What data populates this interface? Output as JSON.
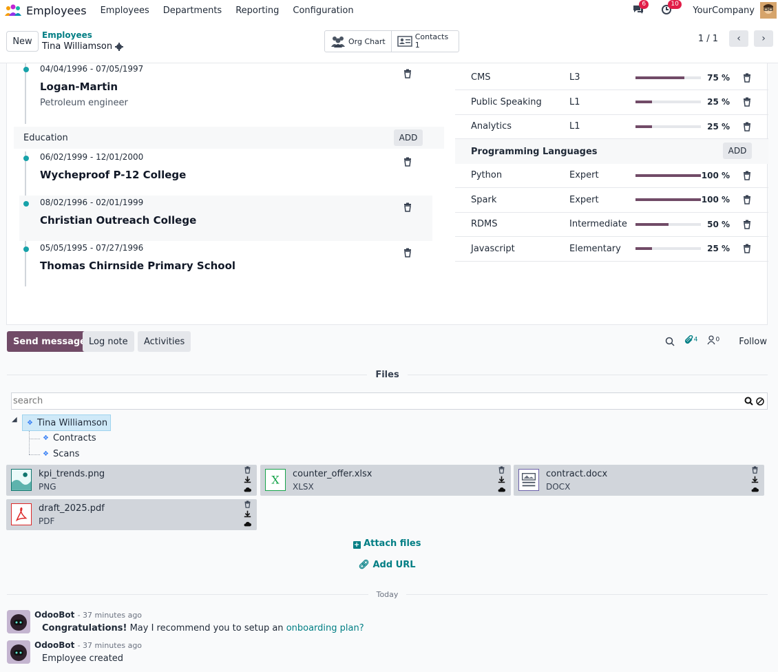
{
  "navbar": {
    "app_title": "Employees",
    "menu": [
      "Employees",
      "Departments",
      "Reporting",
      "Configuration"
    ],
    "messages_count": "6",
    "activities_count": "10",
    "company": "YourCompany"
  },
  "control_panel": {
    "new_label": "New",
    "breadcrumb_parent": "Employees",
    "breadcrumb_current": "Tina Williamson",
    "org_chart_label": "Org Chart",
    "contacts_label": "Contacts",
    "contacts_count": "1",
    "pager_value": "1 / 1"
  },
  "resume": {
    "experience": [
      {
        "date": "04/04/1996 - 07/05/1997",
        "title": "Logan-Martin",
        "description": "Petroleum engineer"
      }
    ],
    "education_label": "Education",
    "add_label": "ADD",
    "education": [
      {
        "date": "06/02/1999 - 12/01/2000",
        "title": "Wycheproof P-12 College"
      },
      {
        "date": "08/02/1996 - 02/01/1999",
        "title": "Christian Outreach College"
      },
      {
        "date": "05/05/1995 - 07/27/1996",
        "title": "Thomas Chirnside Primary School"
      }
    ]
  },
  "skills": {
    "rows_top": [
      {
        "name": "CMS",
        "level": "L3",
        "progress": 75,
        "pct": "75 %"
      },
      {
        "name": "Public Speaking",
        "level": "L1",
        "progress": 25,
        "pct": "25 %"
      },
      {
        "name": "Analytics",
        "level": "L1",
        "progress": 25,
        "pct": "25 %"
      }
    ],
    "type_label": "Programming Languages",
    "add_label": "ADD",
    "rows_prog": [
      {
        "name": "Python",
        "level": "Expert",
        "progress": 100,
        "pct": "100 %"
      },
      {
        "name": "Spark",
        "level": "Expert",
        "progress": 100,
        "pct": "100 %"
      },
      {
        "name": "RDMS",
        "level": "Intermediate",
        "progress": 50,
        "pct": "50 %"
      },
      {
        "name": "Javascript",
        "level": "Elementary",
        "progress": 25,
        "pct": "25 %"
      }
    ]
  },
  "chatter": {
    "send_message": "Send message",
    "log_note": "Log note",
    "activities": "Activities",
    "attachments_count": "4",
    "followers_count": "0",
    "follow": "Follow"
  },
  "files": {
    "title": "Files",
    "search_placeholder": "search",
    "tree_root": "Tina Williamson",
    "tree_children": [
      "Contracts",
      "Scans"
    ],
    "items": [
      {
        "name": "kpi_trends.png",
        "ext": "PNG"
      },
      {
        "name": "counter_offer.xlsx",
        "ext": "XLSX"
      },
      {
        "name": "contract.docx",
        "ext": "DOCX"
      },
      {
        "name": "draft_2025.pdf",
        "ext": "PDF"
      }
    ],
    "attach_files": "Attach files",
    "add_url": "Add URL"
  },
  "messages": {
    "today_label": "Today",
    "items": [
      {
        "author": "OdooBot",
        "time": "- 37 minutes ago",
        "bold": "Congratulations!",
        "text": " May I recommend you to setup an ",
        "link": "onboarding plan?"
      },
      {
        "author": "OdooBot",
        "time": "- 37 minutes ago",
        "text": "Employee created"
      }
    ]
  },
  "colors": {
    "brand": "#714b67",
    "link": "#017e84",
    "timeline_dot": "#17a2a9",
    "badge": "#e11d48"
  }
}
